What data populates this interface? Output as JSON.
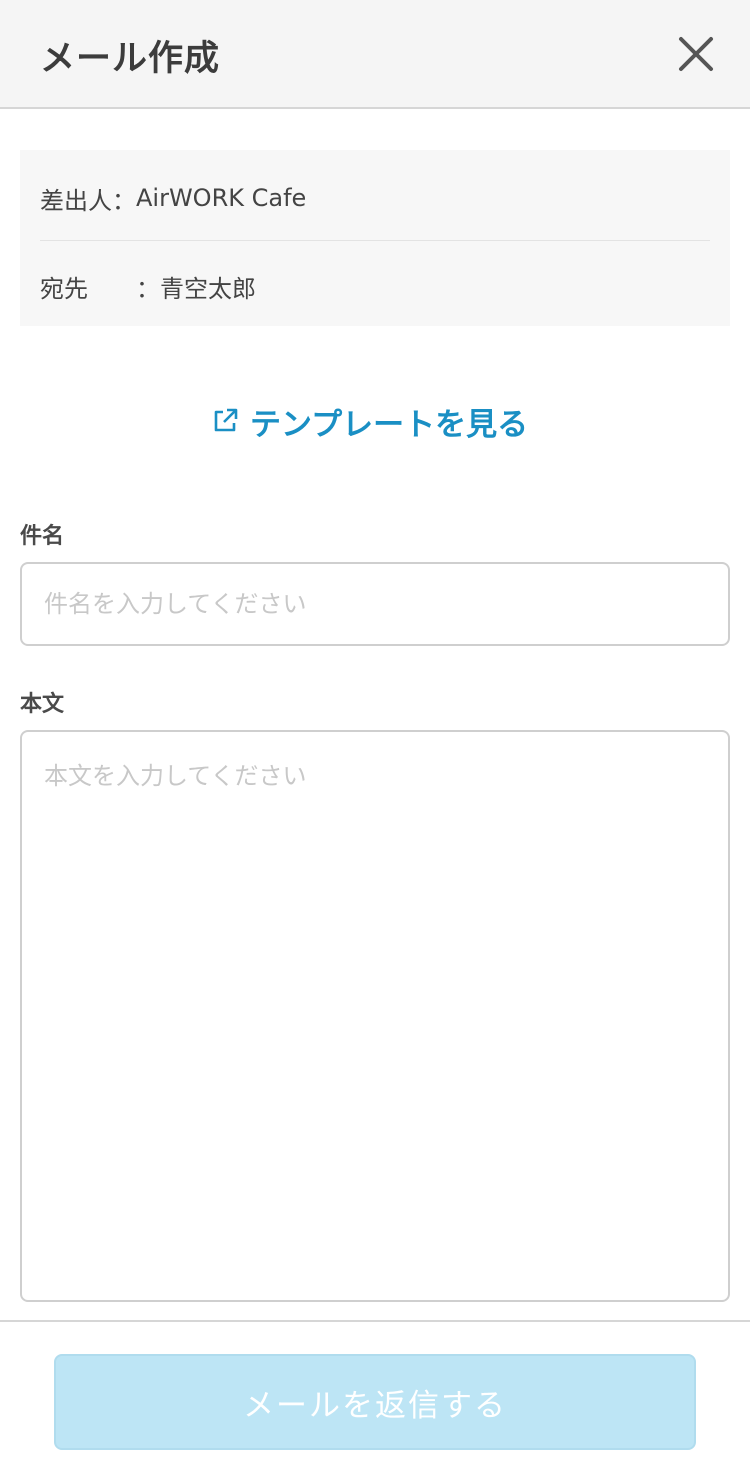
{
  "header": {
    "title": "メール作成",
    "close_icon": "close-icon"
  },
  "info": {
    "sender_label": "差出人：",
    "sender_value": "AirWORK Cafe",
    "recipient_label": "宛先",
    "recipient_sep": "：",
    "recipient_value": "青空太郎"
  },
  "template_link": {
    "label": "テンプレートを見る",
    "icon": "external-link-icon",
    "color": "#1a8fc4"
  },
  "subject": {
    "label": "件名",
    "placeholder": "件名を入力してください",
    "value": ""
  },
  "body": {
    "label": "本文",
    "placeholder": "本文を入力してください",
    "value": ""
  },
  "footer": {
    "send_label": "メールを返信する",
    "send_bg": "#bde5f5"
  }
}
